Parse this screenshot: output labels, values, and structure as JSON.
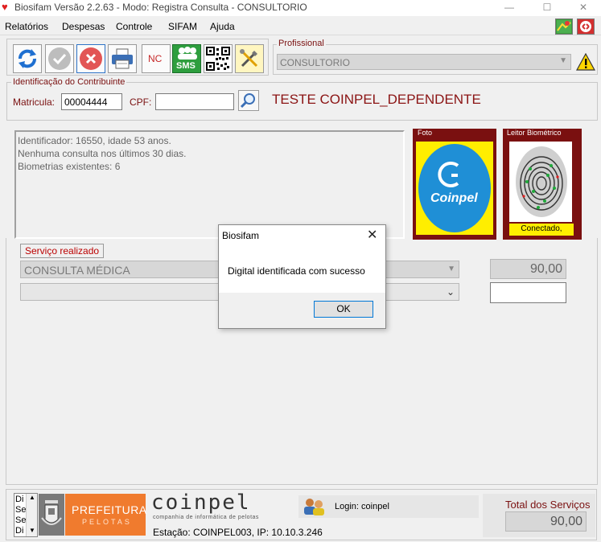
{
  "window": {
    "title": "Biosifam Versão 2.2.63 - Modo: Registra Consulta - CONSULTORIO",
    "minimize": "—",
    "maximize": "☐",
    "close": "✕"
  },
  "menu": {
    "items": [
      "Relatórios",
      "Despesas",
      "Controle",
      "SIFAM",
      "Ajuda"
    ]
  },
  "toolbar": {
    "nc_label": "NC",
    "sms_label": "SMS"
  },
  "profissional": {
    "legend": "Profissional",
    "value": "CONSULTORIO"
  },
  "identificacao": {
    "legend": "Identificação do Contribuinte",
    "matricula_label": "Matricula:",
    "matricula_value": "00004444",
    "cpf_label": "CPF:",
    "cpf_value": "",
    "name": "TESTE COINPEL_DEPENDENTE"
  },
  "info": {
    "lines": [
      "Identificador: 16550, idade 53 anos.",
      "Nenhuma consulta nos últimos 30 dias.",
      "Biometrias existentes: 6"
    ]
  },
  "foto": {
    "legend": "Foto",
    "logo_text": "Coinpel"
  },
  "leitor": {
    "legend": "Leitor Biométrico",
    "status": "Conectado,"
  },
  "servico": {
    "legend": "Serviço realizado",
    "selected": "CONSULTA MÉDICA",
    "value": "90,00",
    "second_selected": "",
    "second_value": ""
  },
  "dialog": {
    "title": "Biosifam",
    "close": "✕",
    "message": "Digital identificada com sucesso",
    "ok": "OK"
  },
  "status": {
    "list_items": [
      "Di",
      "Se",
      "Se",
      "Di"
    ],
    "prefeitura_line1": "PREFEITURA",
    "prefeitura_line2": "PELOTAS",
    "coinpel_logo": "coinpel",
    "coinpel_tagline": "companhia de informática de pelotas",
    "estacao": "Estação: COINPEL003, IP: 10.10.3.246",
    "login": "Login: coinpel",
    "total_label": "Total dos Serviços",
    "total_value": "90,00"
  },
  "colors": {
    "accent_red": "#7a1010",
    "yellow": "#ffee00",
    "prefeitura_orange": "#f07b2e",
    "ok_border": "#0078d7"
  }
}
